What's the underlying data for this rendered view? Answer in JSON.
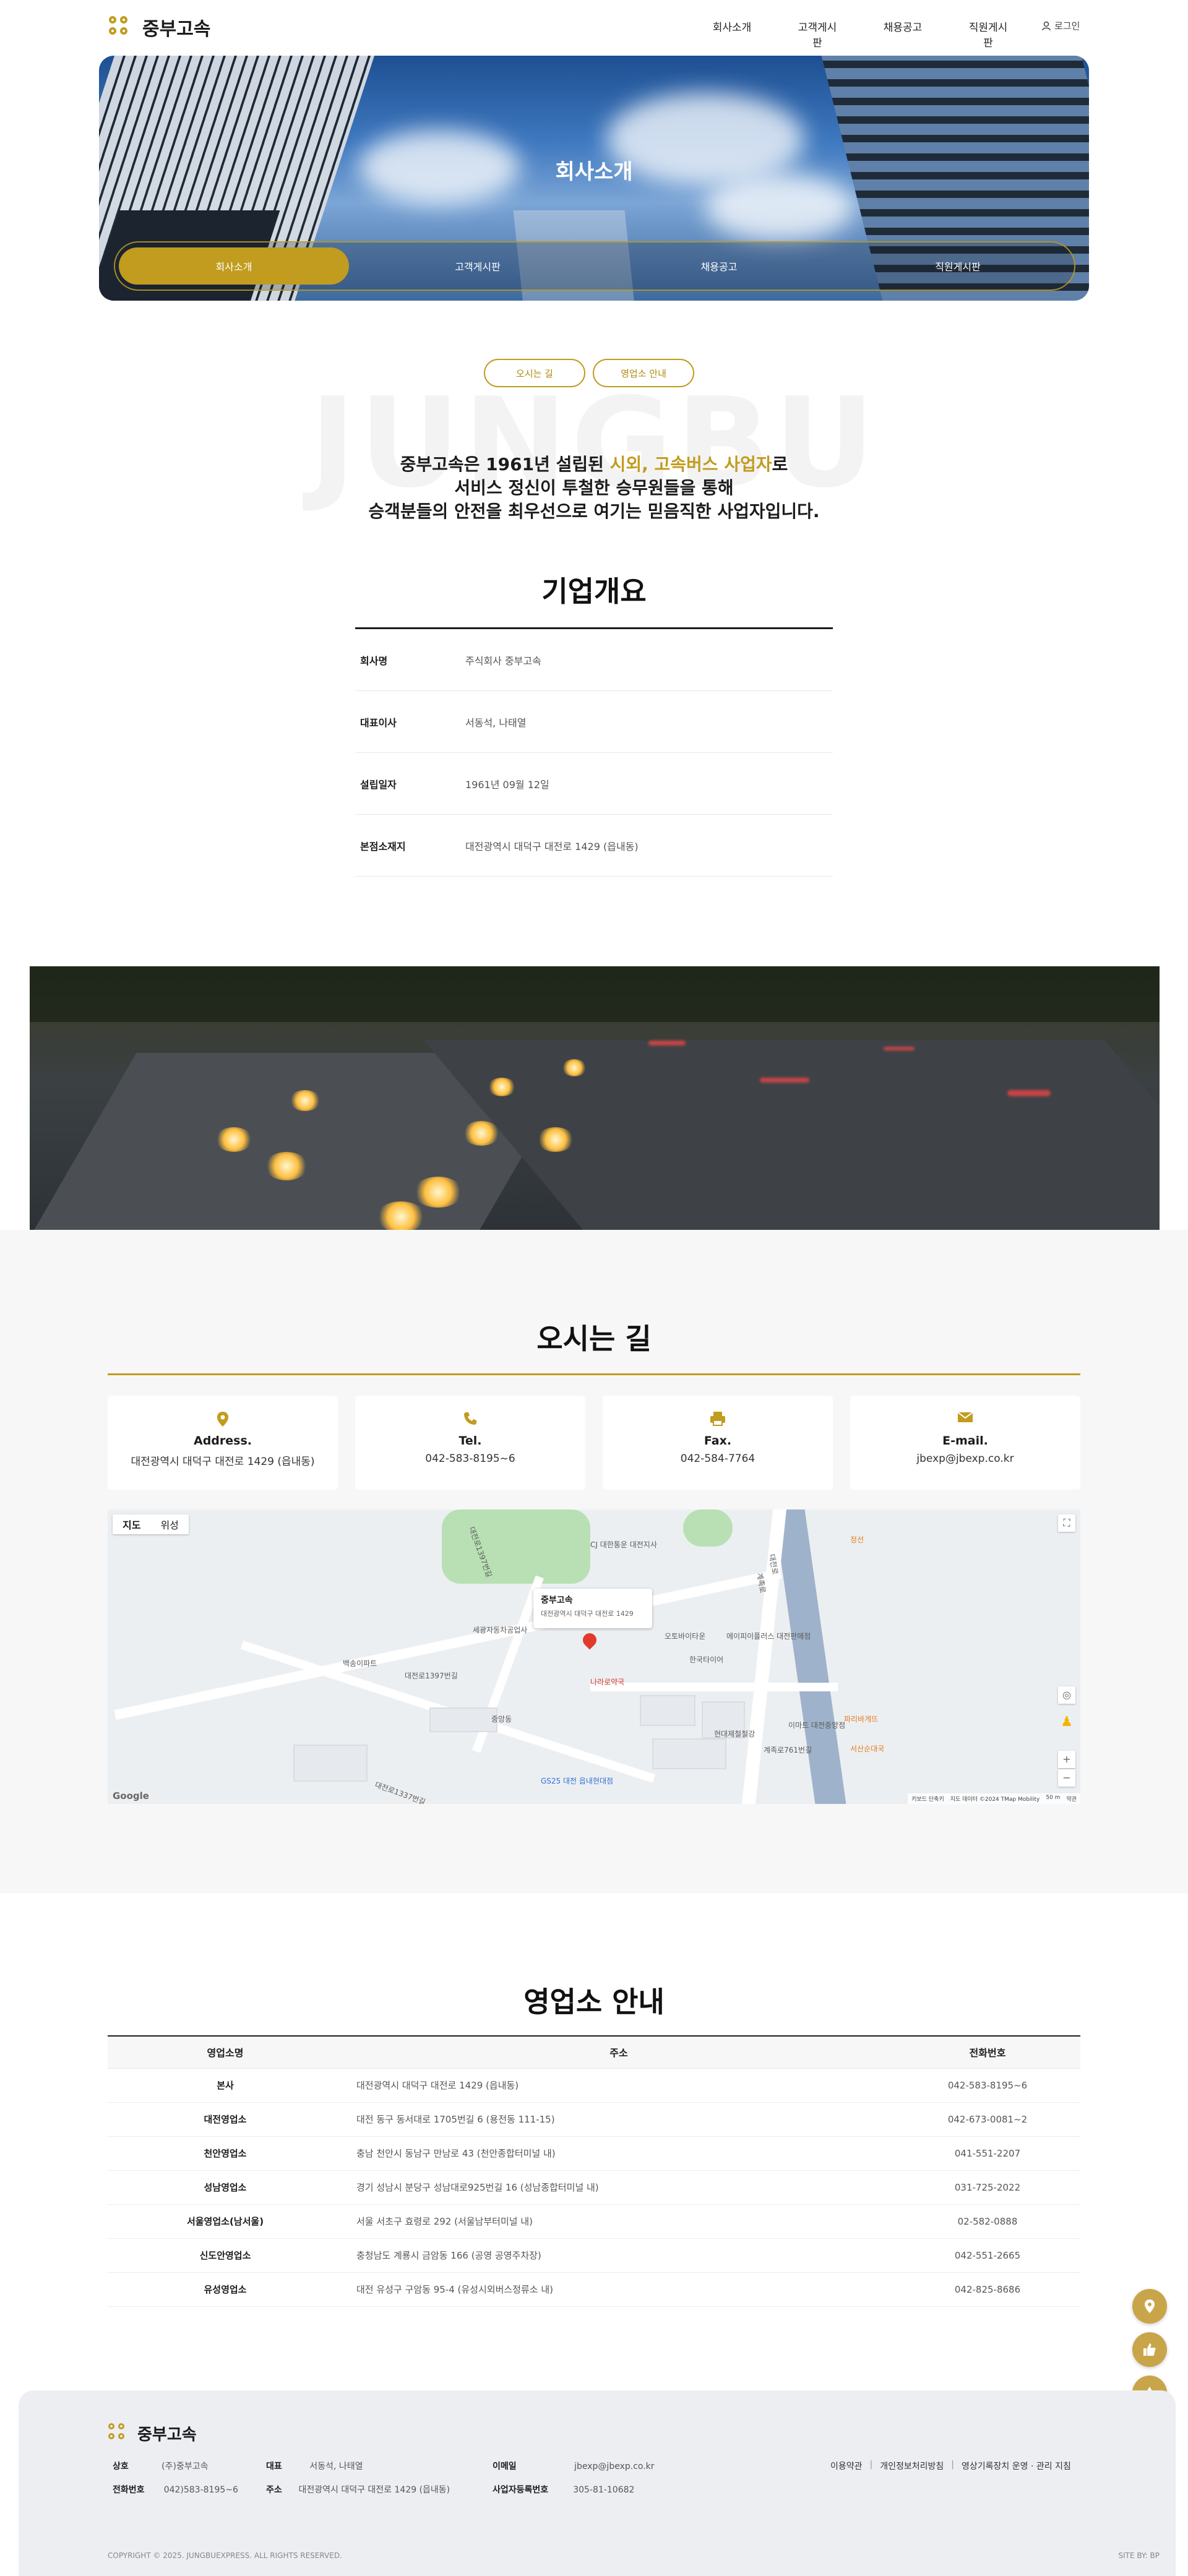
{
  "brand": {
    "name": "중부고속",
    "accent": "#c19c1e"
  },
  "header": {
    "nav": [
      "회사소개",
      "고객게시판",
      "채용공고",
      "직원게시판"
    ],
    "login": "로그인"
  },
  "hero": {
    "title": "회사소개",
    "tabs": [
      "회사소개",
      "고객게시판",
      "채용공고",
      "직원게시판"
    ]
  },
  "intro": {
    "pills": [
      "오시는 길",
      "영업소 안내"
    ],
    "watermark": "JUNGBU",
    "line1_pre": "중부고속은 1961년 설립된 ",
    "line1_hl": "시외, 고속버스 사업자",
    "line1_post": "로",
    "line2": "서비스 정신이 투철한 승무원들을 통해",
    "line3": "승객분들의 안전을 최우선으로 여기는 믿음직한 사업자입니다."
  },
  "overview": {
    "title": "기업개요",
    "rows": [
      {
        "label": "회사명",
        "value": "주식회사 중부고속"
      },
      {
        "label": "대표이사",
        "value": "서동석, 나태열"
      },
      {
        "label": "설립일자",
        "value": "1961년 09월 12일"
      },
      {
        "label": "본점소재지",
        "value": "대전광역시 대덕구 대전로 1429 (읍내동)"
      }
    ]
  },
  "location": {
    "title": "오시는 길",
    "cards": [
      {
        "icon": "map-pin-icon",
        "title": "Address.",
        "value": "대전광역시 대덕구 대전로 1429 (읍내동)"
      },
      {
        "icon": "phone-icon",
        "title": "Tel.",
        "value": "042-583-8195~6"
      },
      {
        "icon": "printer-icon",
        "title": "Fax.",
        "value": "042-584-7764"
      },
      {
        "icon": "mail-icon",
        "title": "E-mail.",
        "value": "jbexp@jbexp.co.kr"
      }
    ],
    "map": {
      "tabs": [
        "지도",
        "위성"
      ],
      "popup_name": "중부고속",
      "popup_addr": "대전광역시 대덕구 대전로 1429",
      "labels": [
        "CJ 대한통운 대전지사",
        "대전로1397번길",
        "대전로1337번길",
        "백송이파트",
        "나라로약국",
        "오토바이타운",
        "한국타이어",
        "현대제철철강",
        "대전로1397번길",
        "세광자동차공업사",
        "대전로",
        "이마트 대전중앙점",
        "중앙동",
        "GS25 대전 읍내현대점",
        "계족로",
        "계족로761번길",
        "에이피이플러스 대전판매점",
        "서산순대국",
        "파리바게뜨",
        "정선"
      ],
      "footer_items": [
        "키보드 단축키",
        "지도 데이터 ©2024 TMap Mobility",
        "50 m",
        "약관"
      ],
      "google": "Google"
    }
  },
  "branches": {
    "title": "영업소 안내",
    "headers": [
      "영업소명",
      "주소",
      "전화번호"
    ],
    "rows": [
      {
        "name": "본사",
        "address": "대전광역시 대덕구 대전로 1429 (읍내동)",
        "phone": "042-583-8195~6"
      },
      {
        "name": "대전영업소",
        "address": "대전 동구 동서대로 1705번길 6 (용전동 111-15)",
        "phone": "042-673-0081~2"
      },
      {
        "name": "천안영업소",
        "address": "충남 천안시 동남구 만남로 43 (천안종합터미널 내)",
        "phone": "041-551-2207"
      },
      {
        "name": "성남영업소",
        "address": "경기 성남시 분당구 성남대로925번길 16 (성남종합터미널 내)",
        "phone": "031-725-2022"
      },
      {
        "name": "서울영업소(남서울)",
        "address": "서울 서초구 효령로 292 (서울남부터미널 내)",
        "phone": "02-582-0888"
      },
      {
        "name": "신도안영업소",
        "address": "충청남도 계룡시 금암동 166 (공영 공영주차장)",
        "phone": "042-551-2665"
      },
      {
        "name": "유성영업소",
        "address": "대전 유성구 구암동 95-4 (유성시외버스정류소 내)",
        "phone": "042-825-8686"
      }
    ]
  },
  "quick": [
    "location-icon",
    "thumbs-up-icon",
    "warning-icon",
    "search-icon",
    "briefcase-icon",
    "group-icon"
  ],
  "footer": {
    "logo": "중부고속",
    "company_label": "상호",
    "company": "(주)중부고속",
    "ceo_label": "대표",
    "ceo": "서동석, 나태열",
    "email_label": "이메일",
    "email": "jbexp@jbexp.co.kr",
    "tel_label": "전화번호",
    "tel": "042)583-8195~6",
    "addr_label": "주소",
    "addr": "대전광역시 대덕구 대전로 1429 (읍내동)",
    "biz_label": "사업자등록번호",
    "biz": "305-81-10682",
    "links": [
      "이용약관",
      "개인정보처리방침",
      "영상기록장치 운영 · 관리 지침"
    ],
    "copyright": "COPYRIGHT © 2025. JUNGBUEXPRESS. ALL RIGHTS RESERVED.",
    "ip": "SITE BY: BP"
  }
}
